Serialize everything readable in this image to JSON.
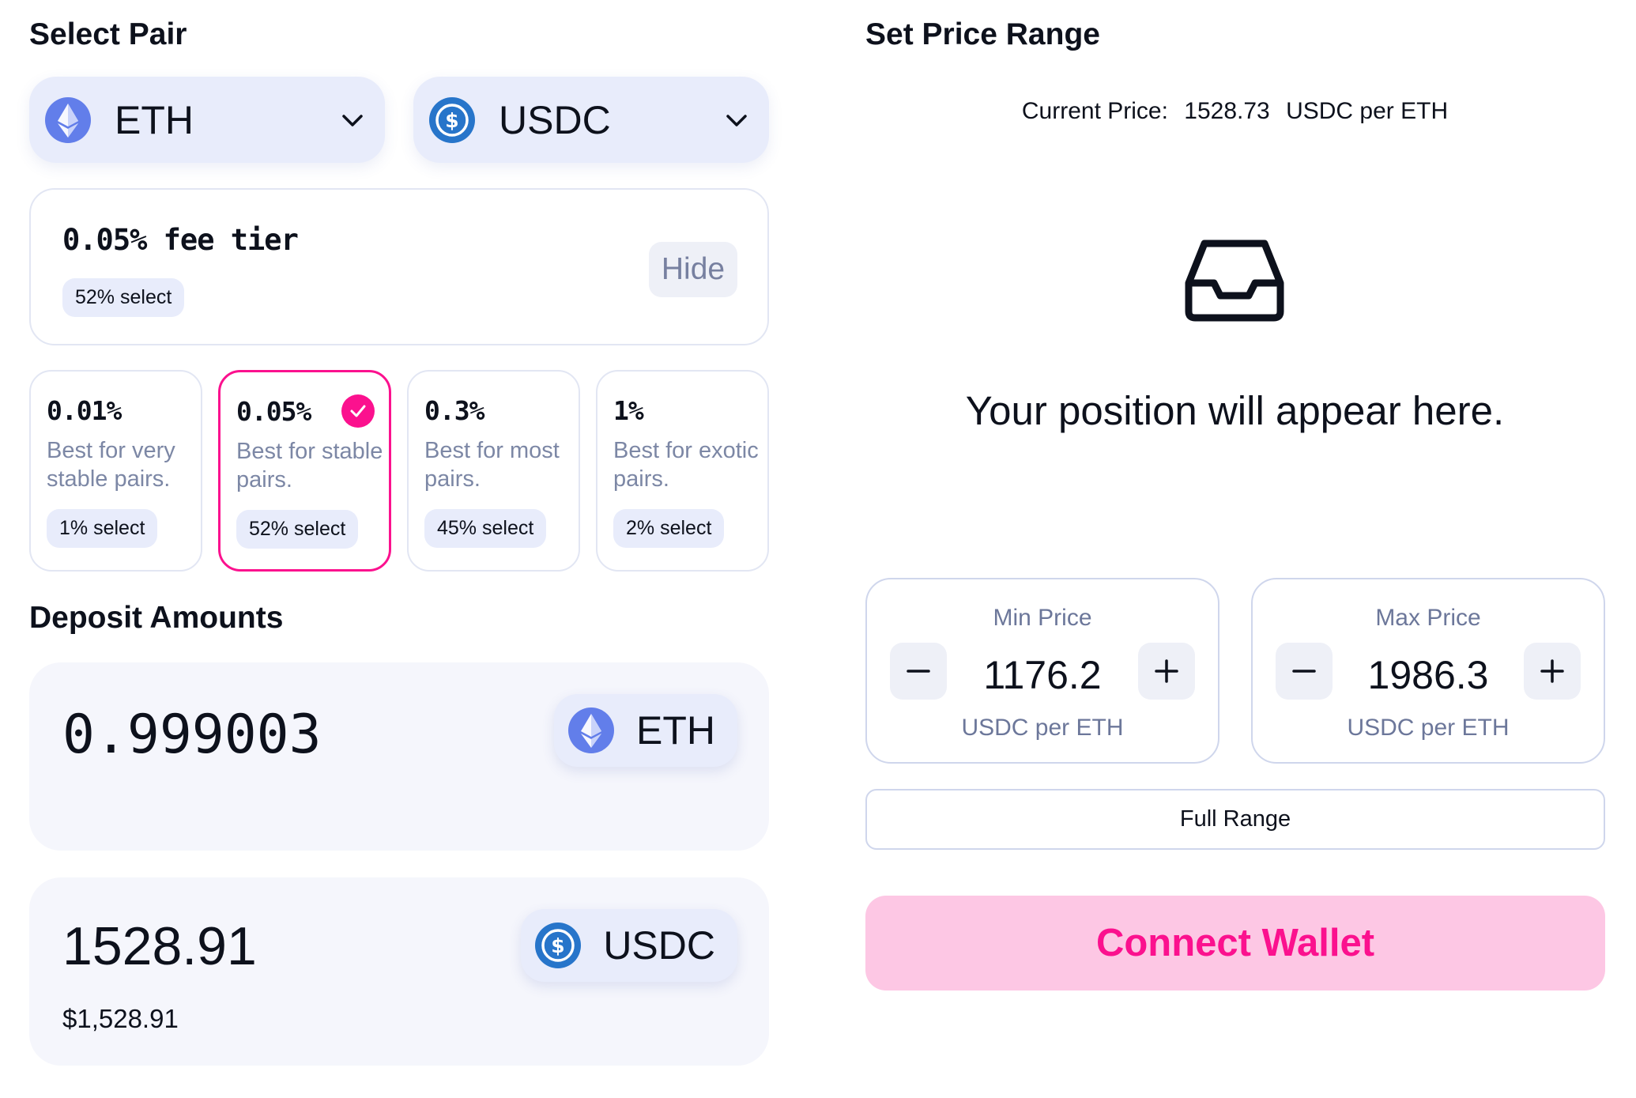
{
  "select_pair": {
    "title": "Select Pair",
    "token_a": {
      "symbol": "ETH",
      "icon": "eth-icon"
    },
    "token_b": {
      "symbol": "USDC",
      "icon": "usdc-icon"
    }
  },
  "fee_summary": {
    "title": "0.05% fee tier",
    "select_pct": "52% select",
    "hide_label": "Hide"
  },
  "fee_tiers": [
    {
      "pct": "0.01%",
      "desc": "Best for very stable pairs.",
      "select": "1% select",
      "selected": false
    },
    {
      "pct": "0.05%",
      "desc": "Best for stable pairs.",
      "select": "52% select",
      "selected": true
    },
    {
      "pct": "0.3%",
      "desc": "Best for most pairs.",
      "select": "45% select",
      "selected": false
    },
    {
      "pct": "1%",
      "desc": "Best for exotic pairs.",
      "select": "2% select",
      "selected": false
    }
  ],
  "deposit": {
    "title": "Deposit Amounts",
    "eth": {
      "amount": "0.999003",
      "symbol": "ETH"
    },
    "usdc": {
      "amount": "1528.91",
      "symbol": "USDC",
      "usd_value": "$1,528.91"
    }
  },
  "price_range": {
    "title": "Set Price Range",
    "current_price_label": "Current Price:",
    "current_price_value": "1528.73",
    "current_price_unit": "USDC per ETH",
    "empty_message": "Your position will appear here.",
    "min": {
      "label": "Min Price",
      "value": "1176.2",
      "unit": "USDC per ETH"
    },
    "max": {
      "label": "Max Price",
      "value": "1986.3",
      "unit": "USDC per ETH"
    },
    "full_range_label": "Full Range"
  },
  "connect_wallet_label": "Connect Wallet",
  "colors": {
    "accent_pink": "#fb118e",
    "connect_bg": "#fdc7e4",
    "token_pill_bg": "#e8ecfb",
    "eth_blue": "#627eea",
    "usdc_blue": "#2775ca"
  }
}
